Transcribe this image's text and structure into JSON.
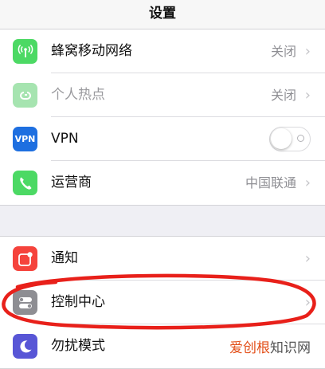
{
  "header": {
    "title": "设置"
  },
  "group1": {
    "rows": [
      {
        "label": "蜂窝移动网络",
        "value": "关闭",
        "icon": "antenna-icon",
        "color": "#4cd964"
      },
      {
        "label": "个人热点",
        "value": "关闭",
        "icon": "hotspot-icon",
        "color": "#a6e4b0"
      },
      {
        "label": "VPN",
        "icon_text": "VPN",
        "icon": "vpn-icon",
        "color": "#1e6fe0",
        "toggle": "off"
      },
      {
        "label": "运营商",
        "value": "中国联通",
        "icon": "phone-icon",
        "color": "#4cd964"
      }
    ]
  },
  "group2": {
    "rows": [
      {
        "label": "通知",
        "icon": "notifications-icon",
        "color": "#f5433c"
      },
      {
        "label": "控制中心",
        "icon": "control-center-icon",
        "color": "#8e8e93"
      },
      {
        "label": "勿扰模式",
        "icon": "moon-icon",
        "color": "#5856d6"
      }
    ]
  },
  "chevron": "›",
  "watermark": {
    "part1": "爱创根",
    "part2": "知识网"
  },
  "annotation": {
    "color": "#e8201a"
  }
}
